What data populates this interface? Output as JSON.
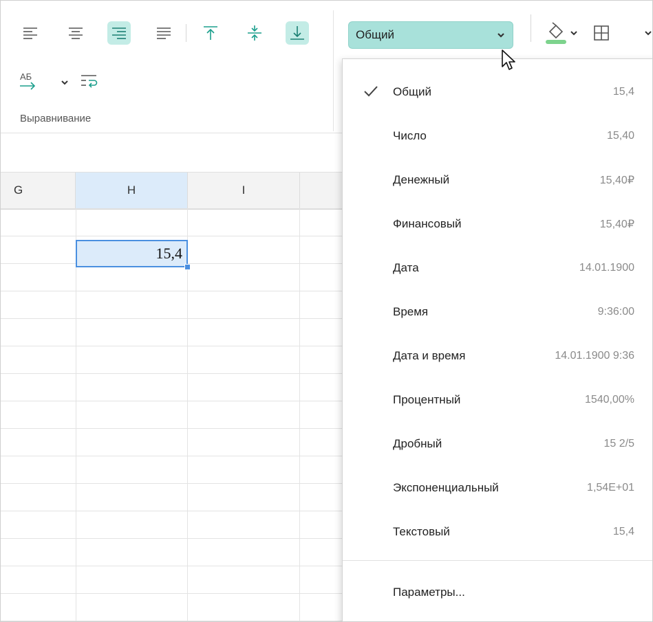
{
  "ribbon": {
    "group_label": "Выравнивание",
    "number_format": {
      "value": "Общий"
    },
    "accent_color": "#a8e1da",
    "icons": [
      "align-left-icon",
      "align-center-icon",
      "align-right-icon",
      "align-justify-icon",
      "align-top-icon",
      "align-middle-icon",
      "align-bottom-icon",
      "text-direction-icon",
      "wrap-text-icon",
      "fill-color-icon",
      "borders-icon"
    ]
  },
  "sheet": {
    "columns": [
      "G",
      "H",
      "I"
    ],
    "selected_column": "H",
    "selected_cell_value": "15,4"
  },
  "format_menu": {
    "items": [
      {
        "label": "Общий",
        "sample": "15,4",
        "checked": true
      },
      {
        "label": "Число",
        "sample": "15,40"
      },
      {
        "label": "Денежный",
        "sample": "15,40₽"
      },
      {
        "label": "Финансовый",
        "sample": "15,40₽"
      },
      {
        "label": "Дата",
        "sample": "14.01.1900"
      },
      {
        "label": "Время",
        "sample": "9:36:00"
      },
      {
        "label": "Дата и время",
        "sample": "14.01.1900 9:36"
      },
      {
        "label": "Процентный",
        "sample": "1540,00%"
      },
      {
        "label": "Дробный",
        "sample": "15 2/5"
      },
      {
        "label": "Экспоненциальный",
        "sample": "1,54E+01"
      },
      {
        "label": "Текстовый",
        "sample": "15,4"
      }
    ],
    "parameters_label": "Параметры..."
  }
}
